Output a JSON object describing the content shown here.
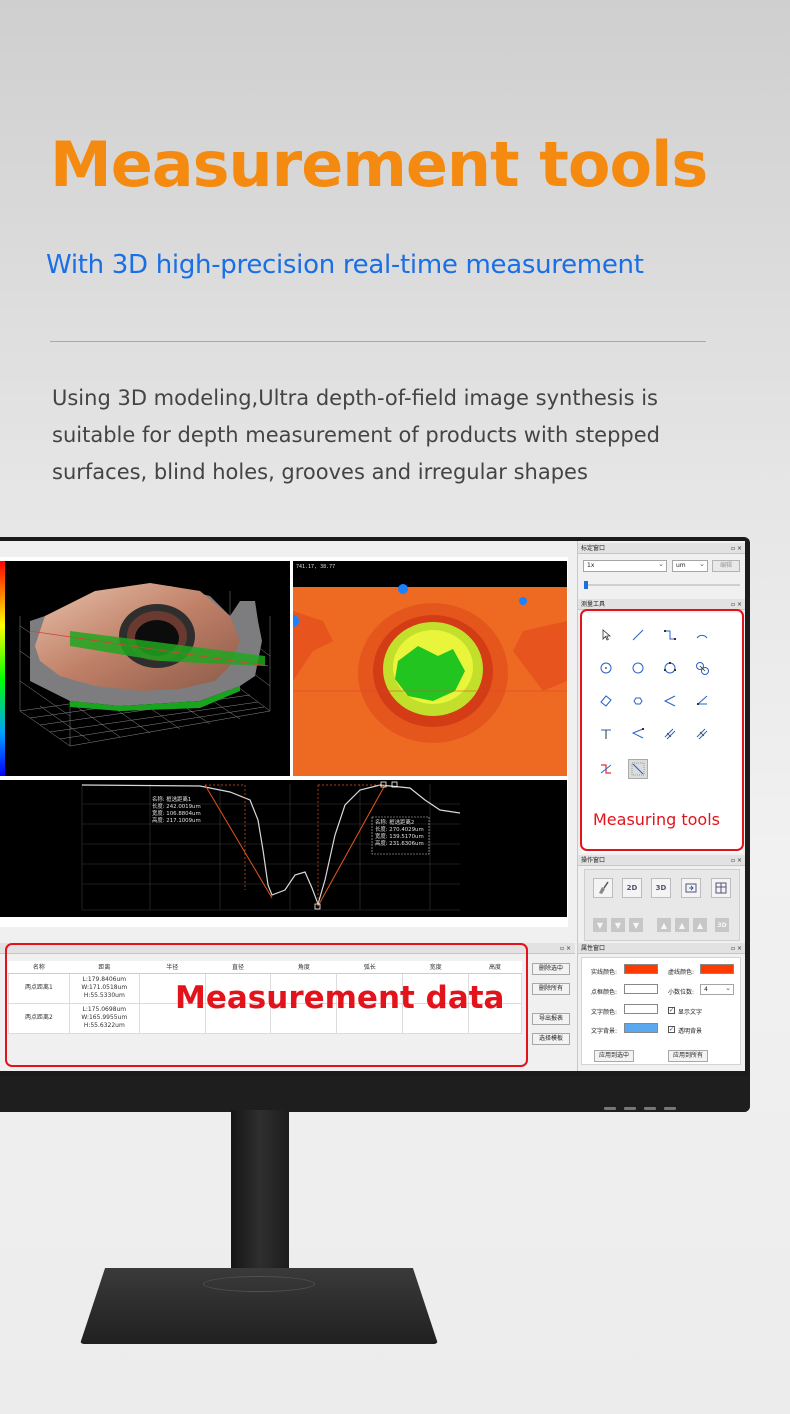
{
  "marketing": {
    "headline": "Measurement tools",
    "subheadline": "With 3D high-precision real-time measurement",
    "description_lines": [
      "Using 3D modeling,Ultra depth-of-field image synthesis is",
      "suitable for depth measurement of products with stepped",
      "surfaces, blind holes, grooves and irregular shapes"
    ]
  },
  "viewer": {
    "heatmap_coord": "741.17, 38.77",
    "profile_label_1": {
      "name": "名称:  框选距离1",
      "length": "长度:  242.0019um",
      "width": "宽度:  106.8804um",
      "height": "高度:  217.1009um"
    },
    "profile_label_2": {
      "name": "名称:  框选距离2",
      "length": "长度:  270.4029um",
      "width": "宽度:  139.5170um",
      "height": "高度:  231.6306um"
    }
  },
  "calibration_panel": {
    "title": "标定窗口",
    "zoom_value": "1x",
    "unit_value": "um",
    "edit_label": "编辑",
    "window_controls": "▫ ×"
  },
  "measure_panel": {
    "title": "测量工具",
    "window_controls": "▫ ×",
    "tool_icons": [
      "pointer-icon",
      "line-icon",
      "polyline-icon",
      "arc-icon",
      "circle-center-icon",
      "circle-icon",
      "circle-3pt-icon",
      "two-circles-icon",
      "rectangle-icon",
      "polygon-icon",
      "angle-icon",
      "angle-2-icon",
      "perpendicular-icon",
      "point-line-icon",
      "parallel-lines-icon",
      "parallel-lines-2-icon",
      "depth-profile-icon",
      "box-distance-icon"
    ]
  },
  "operation_panel": {
    "title": "操作窗口",
    "window_controls": "▫ ×",
    "op_labels": [
      "",
      "2D",
      "3D",
      "",
      ""
    ],
    "nav_3d_label": "3D"
  },
  "property_panel": {
    "title": "属性窗口",
    "window_controls": "▫ ×",
    "solid_line_color_label": "实线颜色:",
    "dashed_line_color_label": "虚线颜色:",
    "point_color_label": "点框颜色:",
    "decimals_label": "小数位数:",
    "decimals_value": "4",
    "text_color_label": "文字颜色:",
    "show_text_label": "显示文字",
    "text_bg_label": "文字背景:",
    "transparent_bg_label": "透明背景",
    "apply_selected": "应用到选中",
    "apply_all": "应用到所有",
    "solid_line_color": "#ff3a00",
    "dashed_line_color": "#ff3a00",
    "point_color": "#ffffff",
    "text_color": "#ffffff",
    "text_bg_color": "#5aa8f0"
  },
  "data_panel": {
    "window_controls": "▫ ×",
    "columns": [
      "名称",
      "距离",
      "半径",
      "直径",
      "角度",
      "弧长",
      "宽度",
      "高度"
    ],
    "rows": [
      {
        "name": "两点距离1",
        "distance_l": "L:179.8406um",
        "distance_w": "W:171.0518um",
        "distance_h": "H:55.5330um"
      },
      {
        "name": "两点距离2",
        "distance_l": "L:175.0698um",
        "distance_w": "W:165.9955um",
        "distance_h": "H:55.6322um"
      }
    ],
    "delete_selected": "删除选中",
    "delete_all": "删除所有",
    "export_report": "导出报表",
    "select_template": "选择模板"
  },
  "callouts": {
    "measuring_tools": "Measuring tools",
    "measurement_data": "Measurement data",
    "color": "#e3131b"
  }
}
